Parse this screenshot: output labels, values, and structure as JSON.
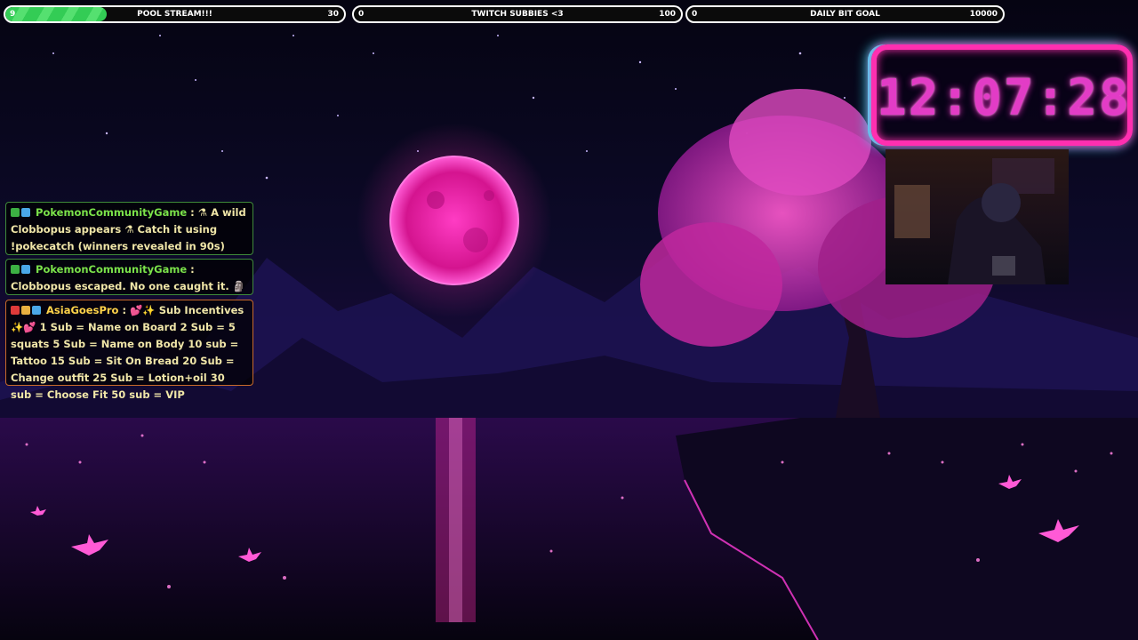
{
  "goals": [
    {
      "current": "9",
      "title": "POOL STREAM!!!",
      "target": "30",
      "progress": 0.3
    },
    {
      "current": "0",
      "title": "TWITCH SUBBIES <3",
      "target": "100",
      "progress": 0
    },
    {
      "current": "0",
      "title": "DAILY BIT GOAL",
      "target": "10000",
      "progress": 0
    }
  ],
  "chat": [
    {
      "user": "PokemonCommunityGame",
      "text": ": ⚗ A wild Clobbopus appears ⚗ Catch it using !pokecatch (winners revealed in 90s)"
    },
    {
      "user": "PokemonCommunityGame",
      "text": ": Clobbopus escaped. No one caught it. 🗿"
    },
    {
      "user": "AsiaGoesPro",
      "text": ": 💕✨ Sub Incentives ✨💕 1 Sub = Name on Board 2 Sub = 5 squats 5 Sub = Name on Body 10 sub = Tattoo 15 Sub = Sit On Bread 20 Sub = Change outfit 25 Sub = Lotion+oil 30 sub = Choose Fit 50 sub = VIP"
    }
  ],
  "clock": {
    "time": "12:07:28"
  },
  "colors": {
    "accent": "#ff2fb0",
    "secondary": "#33f0ff",
    "moon": "#e0169a",
    "goal_fill": "#33cc55"
  }
}
